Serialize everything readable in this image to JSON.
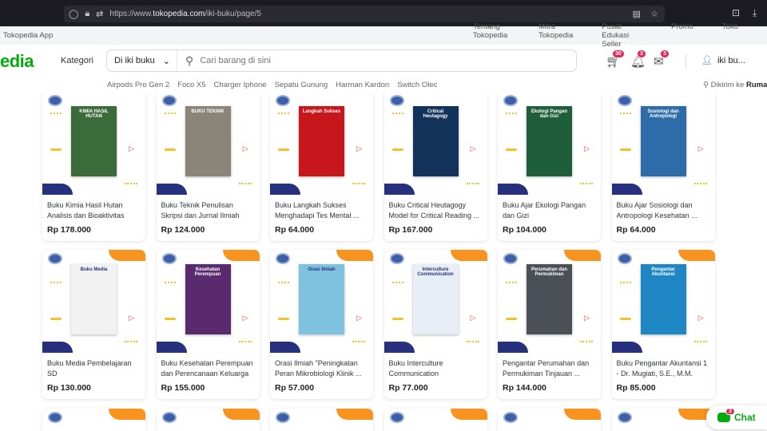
{
  "browser": {
    "url_prefix": "https://www.",
    "url_domain": "tokopedia.com",
    "url_path": "/iki-buku/page/5"
  },
  "topbar": {
    "app": "Tokopedia App",
    "links": [
      "Tentang Tokopedia",
      "Mitra Tokopedia",
      "Pusat Edukasi Seller",
      "Promo",
      "Toko"
    ]
  },
  "header": {
    "logo": "edia",
    "kategori": "Kategori",
    "scope": "Di iki buku",
    "search_placeholder": "Cari barang di sini",
    "cart_count": "30",
    "notif_count": "3",
    "mail_count": "3",
    "user": "iki bu...",
    "suggestions": [
      "Airpods Pro Gen 2",
      "Foco X5",
      "Charger Iphone",
      "Sepatu Gunung",
      "Harman Kardon",
      "Switch Olec"
    ],
    "ship_label": "Dikirim ke",
    "ship_dest": "Rumah"
  },
  "products": [
    {
      "name": "Buku Kimia Hasil Hutan Analisis dan Bioaktivitas",
      "price": "Rp 178.000",
      "cover": "#3b6b3a",
      "title": "KIMIA HASIL HUTAN"
    },
    {
      "name": "Buku Teknik Penulisan Skripsi dan Jurnal Ilmiah",
      "price": "Rp 124.000",
      "cover": "#8a8578",
      "title": "BUKU TEKNIK"
    },
    {
      "name": "Buku Langkah Sukses Menghadapi Tes Mental ...",
      "price": "Rp 64.000",
      "cover": "#c8161d",
      "title": "Langkah Sukses"
    },
    {
      "name": "Buku Critical Heutagogy Model for Critical Reading ...",
      "price": "Rp 167.000",
      "cover": "#12325a",
      "title": "Critical Heutagogy"
    },
    {
      "name": "Buku Ajar Ekologi Pangan dan Gizi",
      "price": "Rp 104.000",
      "cover": "#1e5e3a",
      "title": "Ekologi Pangan dan Gizi"
    },
    {
      "name": "Buku Ajar Sosiologi dan Antropologi Kesehatan ...",
      "price": "Rp 64.000",
      "cover": "#2d6ca8",
      "title": "Sosiologi dan Antropologi"
    },
    {
      "name": "Buku Media Pembelajaran SD",
      "price": "Rp 130.000",
      "cover": "#f2f2f2",
      "title": "Buku Media"
    },
    {
      "name": "Buku Kesehatan Perempuan dan Perencanaan Keluarga",
      "price": "Rp 155.000",
      "cover": "#5a2a6e",
      "title": "Kesehatan Perempuan"
    },
    {
      "name": "Orasi Ilmiah \"Peningkatan Peran Mikrobiologi Klinik ...",
      "price": "Rp 57.000",
      "cover": "#7fc2df",
      "title": "Orasi Ilmiah"
    },
    {
      "name": "Buku Interculture Communication",
      "price": "Rp 77.000",
      "cover": "#e8eef6",
      "title": "Interculture Communication"
    },
    {
      "name": "Pengantar Perumahan dan Permukiman Tinjauan ...",
      "price": "Rp 144.000",
      "cover": "#4b4f56",
      "title": "Perumahan dan Permukiman"
    },
    {
      "name": "Buku Pengantar Akuntansi 1 - Dr. Mugiati, S.E., M.M.",
      "price": "Rp 85.000",
      "cover": "#1f86c4",
      "title": "Pengantar Akuntansi"
    }
  ],
  "chat": {
    "label": "Chat",
    "count": "3"
  }
}
